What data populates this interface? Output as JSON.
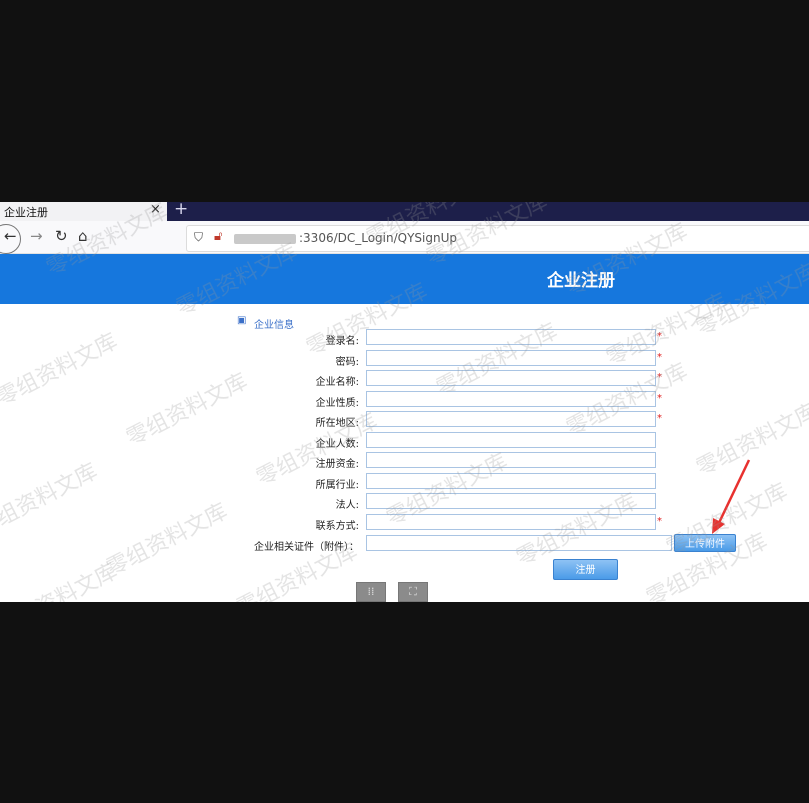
{
  "browser": {
    "tab_title": "企业注册",
    "close_glyph": "×",
    "new_tab_glyph": "+",
    "url_visible": ":3306/DC_Login/QYSignUp"
  },
  "header": {
    "title": "企业注册"
  },
  "section": {
    "label": "企业信息"
  },
  "form": {
    "fields": [
      {
        "label": "登录名:",
        "value": "",
        "required": true
      },
      {
        "label": "密码:",
        "value": "",
        "required": true
      },
      {
        "label": "企业名称:",
        "value": "",
        "required": true
      },
      {
        "label": "企业性质:",
        "value": "",
        "required": true
      },
      {
        "label": "所在地区:",
        "value": "",
        "required": true
      },
      {
        "label": "企业人数:",
        "value": "",
        "required": false
      },
      {
        "label": "注册资金:",
        "value": "",
        "required": false
      },
      {
        "label": "所属行业:",
        "value": "",
        "required": false
      },
      {
        "label": "法人:",
        "value": "",
        "required": false
      },
      {
        "label": "联系方式:",
        "value": "",
        "required": true
      }
    ],
    "attachment_label": "企业相关证件（附件）：",
    "required_mark": "*",
    "upload_button": "上传附件",
    "submit_button": "注册"
  },
  "icons": [
    "back-icon",
    "forward-icon",
    "reload-icon",
    "home-icon",
    "shield-icon",
    "insecure-lock-icon",
    "info-icon"
  ],
  "colors": {
    "banner": "#1677dd",
    "button": "#4a9be8",
    "required": "#e02020",
    "annotation_arrow": "#e8312f"
  },
  "watermark": "零组资料文库"
}
